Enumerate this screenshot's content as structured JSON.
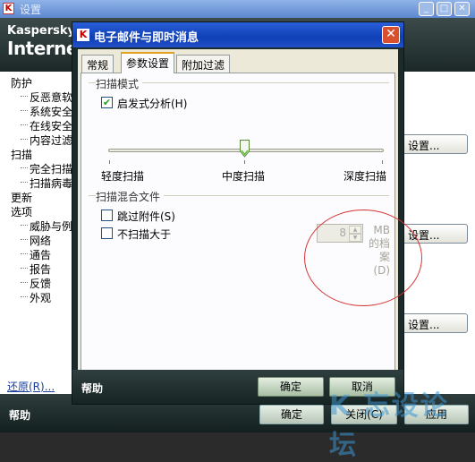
{
  "background_window": {
    "title": "设置",
    "brand_line1": "Kaspersky",
    "brand_line2": "Internet S",
    "nav": {
      "protection": "防护",
      "protection_items": [
        "反恶意软",
        "系统安全",
        "在线安全",
        "内容过滤"
      ],
      "scan": "扫描",
      "scan_items": [
        "完全扫描",
        "扫描病毒"
      ],
      "update": "更新",
      "options": "选项",
      "options_items": [
        "威胁与例",
        "网络",
        "通告",
        "报告",
        "反馈",
        "外观"
      ]
    },
    "restore_link": "还原(R)...",
    "settings_button_label": "设置...",
    "help": "帮助",
    "ok": "确定",
    "close": "关闭(C)",
    "apply": "应用"
  },
  "dialog": {
    "title": "电子邮件与即时消息",
    "tabs": [
      "常规",
      "参数设置",
      "附加过滤"
    ],
    "active_tab": "参数设置",
    "scan_mode_group": "扫描模式",
    "heuristic_label": "启发式分析(H)",
    "heuristic_checked": true,
    "slider": {
      "labels": [
        "轻度扫描",
        "中度扫描",
        "深度扫描"
      ],
      "selected": "中度扫描"
    },
    "compound_group": "扫描混合文件",
    "skip_attachments_label": "跳过附件(S)",
    "skip_attachments_checked": false,
    "no_scan_larger_label": "不扫描大于",
    "no_scan_larger_checked": false,
    "size_value": "8",
    "size_unit_lines": [
      "MB",
      "的档",
      "案",
      "(D)"
    ],
    "help": "帮助",
    "ok": "确定",
    "cancel": "取消"
  },
  "watermark_text": "K 忘设论坛",
  "colors": {
    "xp_blue": "#0f3fb5",
    "kaspersky_dark": "#1c2828",
    "close_red": "#d9502e",
    "annotation_circle": "#d73333"
  }
}
